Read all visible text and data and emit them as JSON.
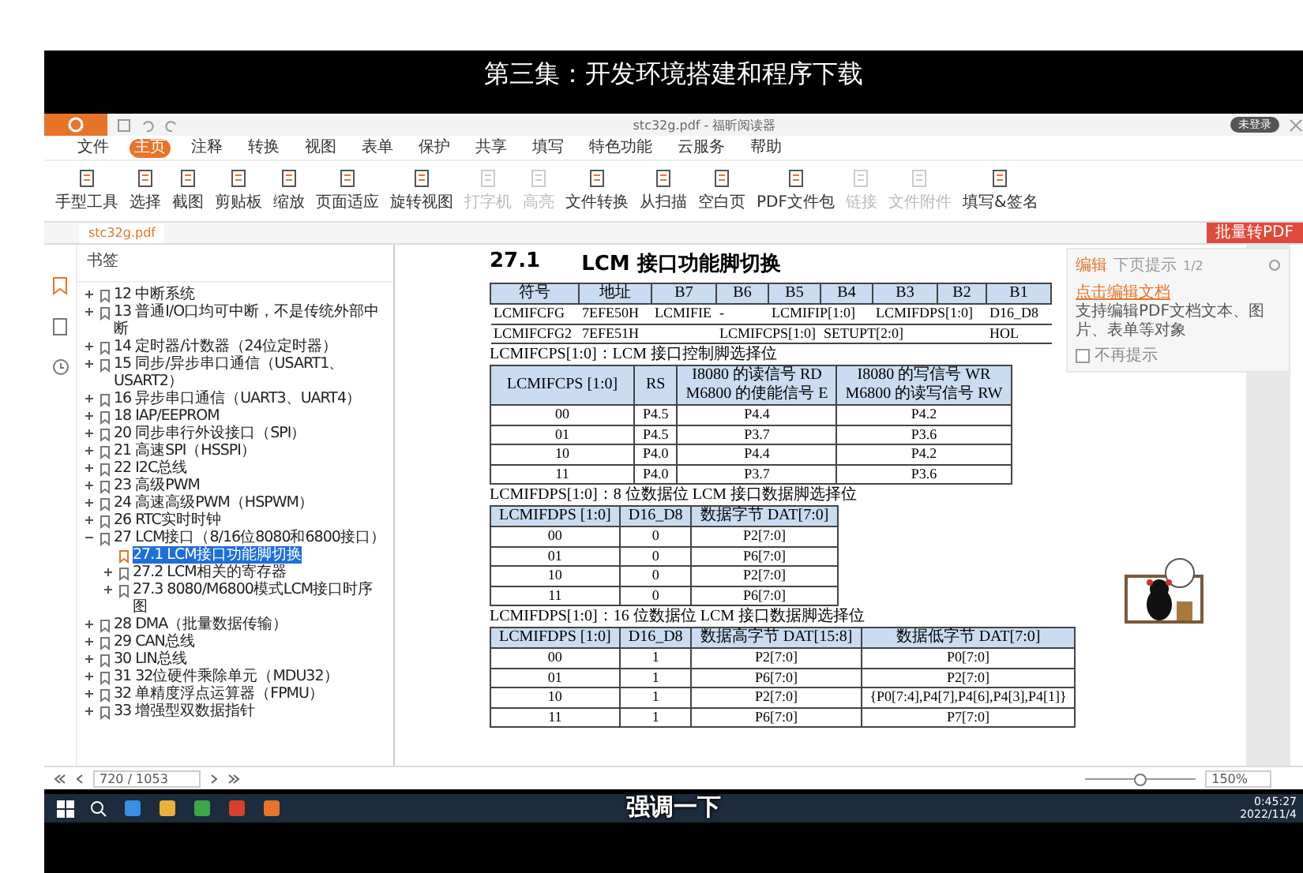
{
  "video_title": "第三集：开发环境搭建和程序下载",
  "app": {
    "title": "stc32g.pdf - 福昕阅读器",
    "account": "未登录",
    "menu": [
      {
        "label": "文件",
        "selected": false
      },
      {
        "label": "主页",
        "selected": true
      },
      {
        "label": "注释",
        "selected": false
      },
      {
        "label": "转换",
        "selected": false
      },
      {
        "label": "视图",
        "selected": false
      },
      {
        "label": "表单",
        "selected": false
      },
      {
        "label": "保护",
        "selected": false
      },
      {
        "label": "共享",
        "selected": false
      },
      {
        "label": "填写",
        "selected": false
      },
      {
        "label": "特色功能",
        "selected": false
      },
      {
        "label": "云服务",
        "selected": false
      },
      {
        "label": "帮助",
        "selected": false
      }
    ],
    "ribbon": [
      {
        "label": "手型工具",
        "disabled": false
      },
      {
        "label": "选择",
        "disabled": false
      },
      {
        "label": "截图",
        "disabled": false
      },
      {
        "label": "剪贴板",
        "disabled": false
      },
      {
        "label": "缩放",
        "disabled": false
      },
      {
        "label": "页面适应",
        "disabled": false
      },
      {
        "label": "旋转视图",
        "disabled": false
      },
      {
        "label": "打字机",
        "disabled": true
      },
      {
        "label": "高亮",
        "disabled": true
      },
      {
        "label": "文件转换",
        "disabled": false
      },
      {
        "label": "从扫描",
        "disabled": false
      },
      {
        "label": "空白页",
        "disabled": false
      },
      {
        "label": "PDF文件包",
        "disabled": false
      },
      {
        "label": "链接",
        "disabled": true
      },
      {
        "label": "文件附件",
        "disabled": true
      },
      {
        "label": "填写&签名",
        "disabled": false
      }
    ],
    "doc_tab": "stc32g.pdf",
    "batch_button": "批量转PDF"
  },
  "sidebar": {
    "title": "书签",
    "bookmarks": [
      {
        "label": "12 中断系统",
        "expanded": false,
        "selected": false
      },
      {
        "label": "13 普通I/O口均可中断，不是传统外部中断",
        "expanded": false,
        "selected": false
      },
      {
        "label": "14 定时器/计数器（24位定时器）",
        "expanded": false,
        "selected": false
      },
      {
        "label": "15 同步/异步串口通信（USART1、USART2）",
        "expanded": false,
        "selected": false
      },
      {
        "label": "16 异步串口通信（UART3、UART4）",
        "expanded": false,
        "selected": false
      },
      {
        "label": "18 IAP/EEPROM",
        "expanded": false,
        "selected": false
      },
      {
        "label": "20 同步串行外设接口（SPI）",
        "expanded": false,
        "selected": false
      },
      {
        "label": "21 高速SPI（HSSPI）",
        "expanded": false,
        "selected": false
      },
      {
        "label": "22 I2C总线",
        "expanded": false,
        "selected": false
      },
      {
        "label": "23 高级PWM",
        "expanded": false,
        "selected": false
      },
      {
        "label": "24 高速高级PWM（HSPWM）",
        "expanded": false,
        "selected": false
      },
      {
        "label": "26 RTC实时时钟",
        "expanded": false,
        "selected": false
      },
      {
        "label": "27 LCM接口（8/16位8080和6800接口）",
        "expanded": true,
        "selected": false,
        "children": [
          {
            "label": "27.1 LCM接口功能脚切换",
            "selected": true
          },
          {
            "label": "27.2 LCM相关的寄存器",
            "expanded": false,
            "selected": false
          },
          {
            "label": "27.3 8080/M6800模式LCM接口时序图",
            "expanded": false,
            "selected": false
          }
        ]
      },
      {
        "label": "28 DMA（批量数据传输）",
        "expanded": false,
        "selected": false
      },
      {
        "label": "29 CAN总线",
        "expanded": false,
        "selected": false
      },
      {
        "label": "30 LIN总线",
        "expanded": false,
        "selected": false
      },
      {
        "label": "31 32位硬件乘除单元（MDU32）",
        "expanded": false,
        "selected": false
      },
      {
        "label": "32 单精度浮点运算器（FPMU）",
        "expanded": false,
        "selected": false
      },
      {
        "label": "33 增强型双数据指针",
        "expanded": false,
        "selected": false
      }
    ]
  },
  "page": {
    "heading_number": "27.1",
    "heading": "LCM 接口功能脚切换",
    "register_table": {
      "columns": [
        "符号",
        "地址",
        "B7",
        "B6",
        "B5",
        "B4",
        "B3",
        "B2",
        "B1"
      ],
      "rows": [
        [
          "LCMIFCFG",
          "7EFE50H",
          "LCMIFIE",
          "-",
          "LCMIFIP[1:0]",
          "",
          "LCMIFDPS[1:0]",
          "",
          "D16_D8"
        ],
        [
          "LCMIFCFG2",
          "7EFE51H",
          "",
          "LCMIFCPS[1:0]",
          "",
          "SETUPT[2:0]",
          "",
          "",
          "HOL"
        ]
      ]
    },
    "tables": [
      {
        "caption": "LCMIFCPS[1:0]：LCM 接口控制脚选择位",
        "columns": [
          "LCMIFCPS [1:0]",
          "RS",
          "I8080 的读信号 RD\nM6800 的使能信号 E",
          "I8080 的写信号 WR\nM6800 的读写信号 RW"
        ],
        "rows": [
          [
            "00",
            "P4.5",
            "P4.4",
            "P4.2"
          ],
          [
            "01",
            "P4.5",
            "P3.7",
            "P3.6"
          ],
          [
            "10",
            "P4.0",
            "P4.4",
            "P4.2"
          ],
          [
            "11",
            "P4.0",
            "P3.7",
            "P3.6"
          ]
        ]
      },
      {
        "caption": "LCMIFDPS[1:0]：8 位数据位 LCM 接口数据脚选择位",
        "columns": [
          "LCMIFDPS [1:0]",
          "D16_D8",
          "数据字节 DAT[7:0]"
        ],
        "rows": [
          [
            "00",
            "0",
            "P2[7:0]"
          ],
          [
            "01",
            "0",
            "P6[7:0]"
          ],
          [
            "10",
            "0",
            "P2[7:0]"
          ],
          [
            "11",
            "0",
            "P6[7:0]"
          ]
        ]
      },
      {
        "caption": "LCMIFDPS[1:0]：16 位数据位 LCM 接口数据脚选择位",
        "columns": [
          "LCMIFDPS [1:0]",
          "D16_D8",
          "数据高字节 DAT[15:8]",
          "数据低字节 DAT[7:0]"
        ],
        "rows": [
          [
            "00",
            "1",
            "P2[7:0]",
            "P0[7:0]"
          ],
          [
            "01",
            "1",
            "P6[7:0]",
            "P2[7:0]"
          ],
          [
            "10",
            "1",
            "P2[7:0]",
            "{P0[7:4],P4[7],P4[6],P4[3],P4[1]}"
          ],
          [
            "11",
            "1",
            "P6[7:0]",
            "P7[7:0]"
          ]
        ]
      }
    ]
  },
  "popup": {
    "tabs": [
      {
        "label": "编辑",
        "selected": true
      },
      {
        "label": "下页提示",
        "selected": false
      }
    ],
    "counter": "1/2",
    "link": "点击编辑文档",
    "text": "支持编辑PDF文档文本、图片、表单等对象",
    "checkbox": {
      "label": "不再提示",
      "checked": false
    }
  },
  "status": {
    "page": "720 / 1053",
    "zoom": "150%",
    "zoom_slider": {
      "level": 0.5
    }
  },
  "taskbar": {
    "time": "0:45:27",
    "date": "2022/11/4"
  },
  "subtitle": "强调一下"
}
